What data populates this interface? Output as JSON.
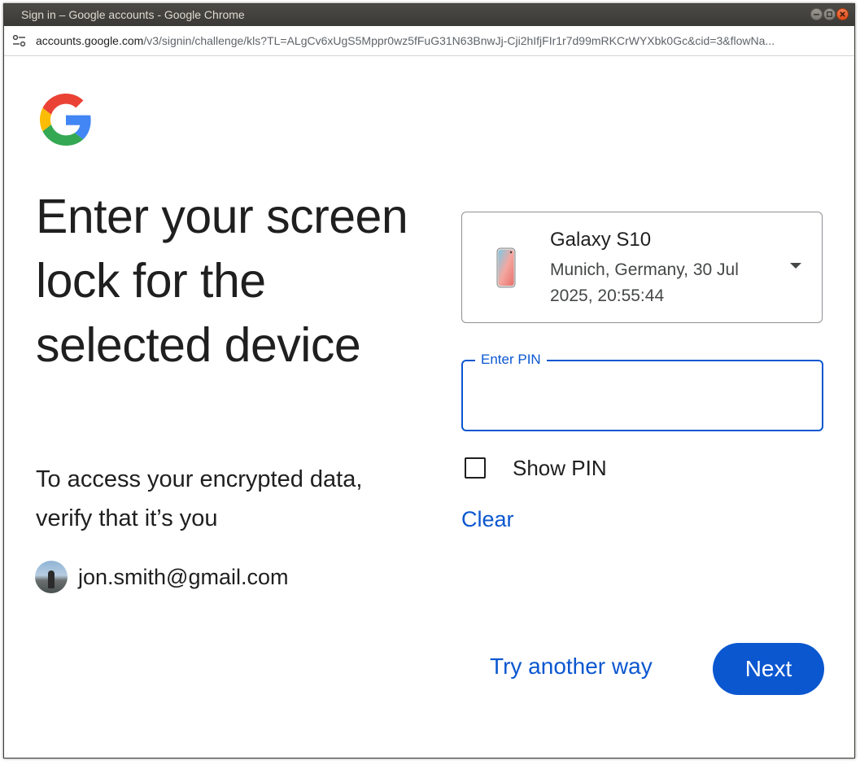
{
  "window": {
    "title": "Sign in – Google accounts - Google Chrome",
    "minimize_icon": "minimize-icon",
    "maximize_icon": "maximize-icon",
    "close_icon": "close-icon"
  },
  "address_bar": {
    "host": "accounts.google.com",
    "path": "/v3/signin/challenge/kls?TL=ALgCv6xUgS5Mppr0wz5fFuG31N63BnwJj-Cji2hIfjFIr1r7d99mRKCrWYXbk0Gc&cid=3&flowNa...",
    "site_info_icon": "tune-icon"
  },
  "page": {
    "logo_icon": "google-logo-icon",
    "heading": "Enter your screen lock for the selected device",
    "subtext": "To access your encrypted data, verify that it’s you",
    "account_email": "jon.smith@gmail.com"
  },
  "device": {
    "name": "Galaxy S10",
    "info": "Munich, Germany, 30 Jul 2025, 20:55:44",
    "icon": "phone-icon"
  },
  "pin": {
    "label": "Enter PIN",
    "value": ""
  },
  "show_pin": {
    "label": "Show PIN",
    "checked": false
  },
  "actions": {
    "clear_label": "Clear",
    "try_another_label": "Try another way",
    "next_label": "Next"
  },
  "colors": {
    "accent": "#0b57d0",
    "text": "#1f1f1f",
    "secondary_text": "#444746",
    "titlebar": "#3c3b37"
  }
}
